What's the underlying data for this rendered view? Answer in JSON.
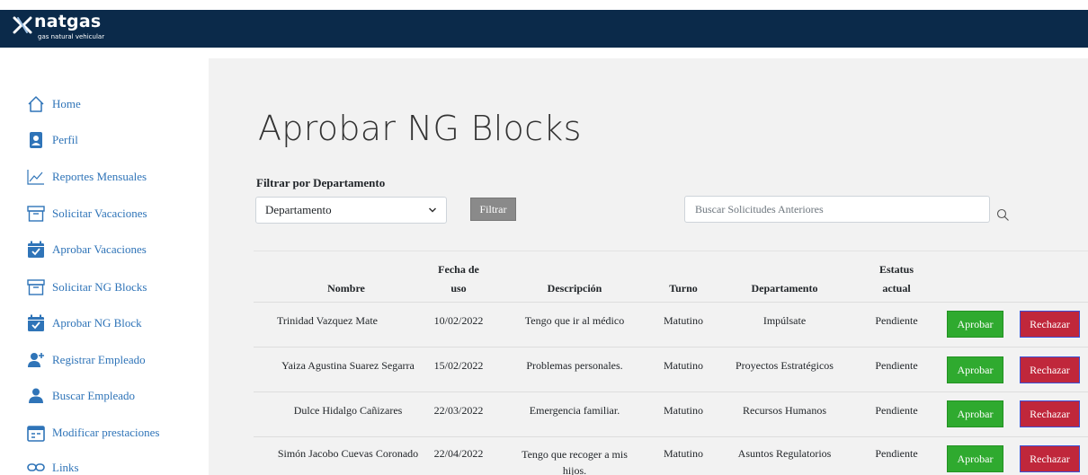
{
  "brand": {
    "name": "natgas",
    "tagline": "gas natural vehicular",
    "header_color": "#0b2a4a",
    "link_color": "#2f74b8",
    "approve_color": "#2faa2f",
    "reject_color": "#c0273b"
  },
  "sidebar": {
    "items": [
      {
        "label": "Home",
        "icon": "home-icon"
      },
      {
        "label": "Perfil",
        "icon": "profile-icon"
      },
      {
        "label": "Reportes Mensuales",
        "icon": "chart-line-icon"
      },
      {
        "label": "Solicitar Vacaciones",
        "icon": "archive-icon"
      },
      {
        "label": "Aprobar Vacaciones",
        "icon": "calendar-check-icon"
      },
      {
        "label": "Solicitar NG Blocks",
        "icon": "archive-icon"
      },
      {
        "label": "Aprobar NG Block",
        "icon": "calendar-check-icon"
      },
      {
        "label": "Registrar Empleado",
        "icon": "user-add-icon"
      },
      {
        "label": "Buscar Empleado",
        "icon": "user-icon"
      },
      {
        "label": "Modificar prestaciones",
        "icon": "calendar-edit-icon"
      },
      {
        "label": "Links",
        "icon": "link-icon"
      }
    ]
  },
  "page": {
    "title": "Aprobar NG Blocks",
    "filter_label": "Filtrar por Departamento",
    "department_select": "Departamento",
    "filter_button": "Filtrar",
    "search_placeholder": "Buscar Solicitudes Anteriores"
  },
  "table": {
    "headers": {
      "nombre": "Nombre",
      "fecha_1": "Fecha de",
      "fecha_2": "uso",
      "descripcion": "Descripción",
      "turno": "Turno",
      "departamento": "Departamento",
      "estatus_1": "Estatus",
      "estatus_2": "actual"
    },
    "approve_label": "Aprobar",
    "reject_label": "Rechazar",
    "rows": [
      {
        "nombre": "Trinidad Vazquez Mate",
        "fecha": "10/02/2022",
        "descripcion": "Tengo que ir al médico",
        "turno": "Matutino",
        "departamento": "Impúlsate",
        "estatus": "Pendiente"
      },
      {
        "nombre": "Yaiza Agustina Suarez Segarra",
        "fecha": "15/02/2022",
        "descripcion": "Problemas personales.",
        "turno": "Matutino",
        "departamento": "Proyectos Estratégicos",
        "estatus": "Pendiente"
      },
      {
        "nombre": "Dulce Hidalgo Cañizares",
        "fecha": "22/03/2022",
        "descripcion": "Emergencia familiar.",
        "turno": "Matutino",
        "departamento": "Recursos Humanos",
        "estatus": "Pendiente"
      },
      {
        "nombre": "Simón Jacobo Cuevas Coronado",
        "fecha": "22/04/2022",
        "descripcion": "Tengo que recoger a mis hijos.",
        "turno": "Matutino",
        "departamento": "Asuntos Regulatorios",
        "estatus": "Pendiente"
      }
    ]
  }
}
